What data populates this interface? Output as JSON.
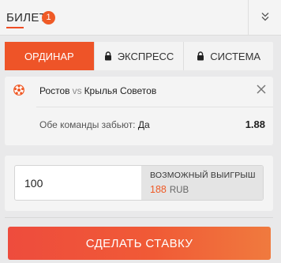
{
  "header": {
    "title": "БИЛЕТ",
    "count": "1"
  },
  "tabs": [
    {
      "label": "ОРДИНАР",
      "active": true,
      "locked": false
    },
    {
      "label": "ЭКСПРЕСС",
      "active": false,
      "locked": true
    },
    {
      "label": "СИСТЕМА",
      "active": false,
      "locked": true
    }
  ],
  "bet": {
    "team_home": "Ростов",
    "vs": "vs",
    "team_away": "Крылья Советов",
    "market": "Обе команды забьют:",
    "pick": "Да",
    "odds": "1.88",
    "sport_icon": "soccer-ball-icon"
  },
  "stake": {
    "value": "100",
    "win_label": "ВОЗМОЖНЫЙ ВЫИГРЫШ",
    "win_amount": "188",
    "currency": "RUB"
  },
  "place_bet_label": "СДЕЛАТЬ СТАВКУ",
  "colors": {
    "accent": "#ee5428",
    "badge": "#ef5a26",
    "button_start": "#ee4c3d",
    "button_end": "#f07a3e"
  }
}
